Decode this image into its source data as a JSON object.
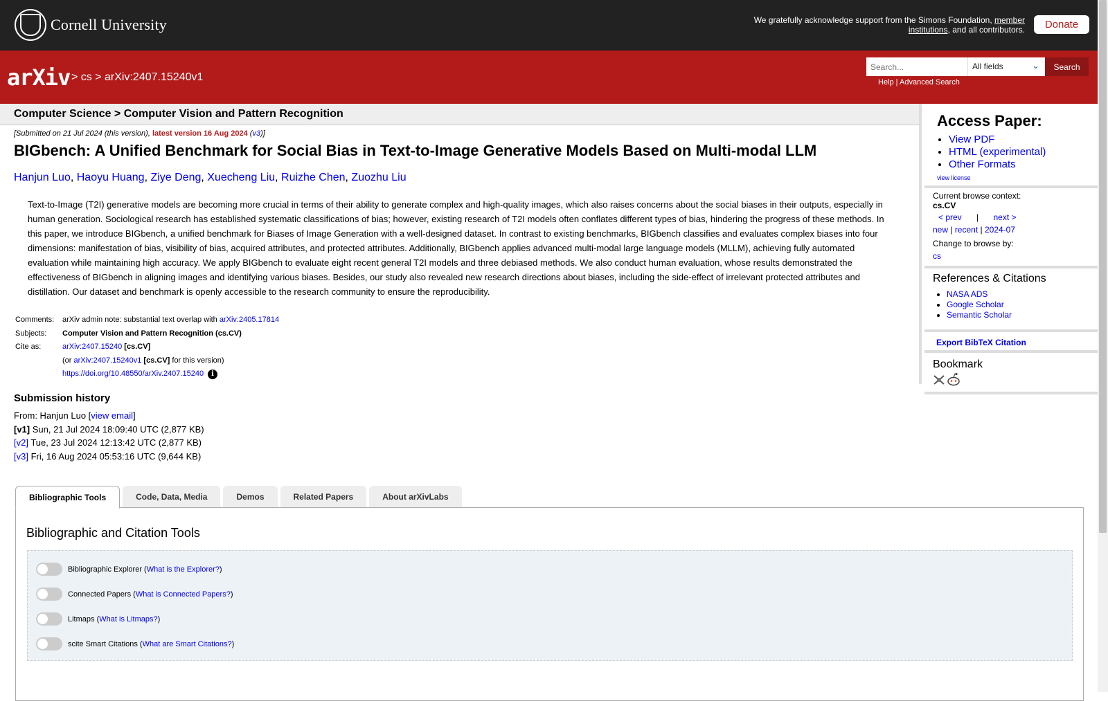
{
  "topbar": {
    "university": "Cornell University",
    "ack_text": "We gratefully acknowledge support from the Simons Foundation, ",
    "ack_link": "member institutions",
    "ack_tail": ", and all contributors.",
    "donate": "Donate"
  },
  "header": {
    "logo": "arXiv",
    "breadcrumb_sep": " > ",
    "crumb_cs": "cs",
    "crumb_id": "arXiv:2407.15240v1",
    "search_placeholder": "Search...",
    "search_field": "All fields",
    "search_button": "Search",
    "help": "Help",
    "advanced": "Advanced Search"
  },
  "subject_header": "Computer Science > Computer Vision and Pattern Recognition",
  "dateline": {
    "submitted": "[Submitted on 21 Jul 2024 (this version), ",
    "latest": "latest version 16 Aug 2024",
    "v3": "v3"
  },
  "paper": {
    "title": "BIGbench: A Unified Benchmark for Social Bias in Text-to-Image Generative Models Based on Multi-modal LLM",
    "authors": [
      "Hanjun Luo",
      "Haoyu Huang",
      "Ziye Deng",
      "Xuecheng Liu",
      "Ruizhe Chen",
      "Zuozhu Liu"
    ],
    "abstract": "Text-to-Image (T2I) generative models are becoming more crucial in terms of their ability to generate complex and high-quality images, which also raises concerns about the social biases in their outputs, especially in human generation. Sociological research has established systematic classifications of bias; however, existing research of T2I models often conflates different types of bias, hindering the progress of these methods. In this paper, we introduce BIGbench, a unified benchmark for Biases of Image Generation with a well-designed dataset. In contrast to existing benchmarks, BIGbench classifies and evaluates complex biases into four dimensions: manifestation of bias, visibility of bias, acquired attributes, and protected attributes. Additionally, BIGbench applies advanced multi-modal large language models (MLLM), achieving fully automated evaluation while maintaining high accuracy. We apply BIGbench to evaluate eight recent general T2I models and three debiased methods. We also conduct human evaluation, whose results demonstrated the effectiveness of BIGbench in aligning images and identifying various biases. Besides, our study also revealed new research directions about biases, including the side-effect of irrelevant protected attributes and distillation. Our dataset and benchmark is openly accessible to the research community to ensure the reproducibility."
  },
  "meta": {
    "comments_label": "Comments:",
    "comments_text": "arXiv admin note: substantial text overlap with ",
    "comments_link": "arXiv:2405.17814",
    "subjects_label": "Subjects:",
    "subjects": "Computer Vision and Pattern Recognition (cs.CV)",
    "cite_label": "Cite as:",
    "cite_id": "arXiv:2407.15240",
    "cite_cat": "[cs.CV]",
    "or_pre": "(or ",
    "or_id": "arXiv:2407.15240v1",
    "or_cat": "[cs.CV]",
    "or_post": " for this version)",
    "doi": "https://doi.org/10.48550/arXiv.2407.15240",
    "info_icon": "i"
  },
  "history": {
    "title": "Submission history",
    "from": "From: Hanjun Luo [",
    "view_email": "view email",
    "from_close": "]",
    "versions": [
      {
        "tag": "[v1]",
        "text": " Sun, 21 Jul 2024 18:09:40 UTC (2,877 KB)"
      },
      {
        "tag": "[v2]",
        "text": " Tue, 23 Jul 2024 12:13:42 UTC (2,877 KB)"
      },
      {
        "tag": "[v3]",
        "text": " Fri, 16 Aug 2024 05:53:16 UTC (9,644 KB)"
      }
    ]
  },
  "sidebar": {
    "access_title": "Access Paper:",
    "access_links": [
      "View PDF",
      "HTML (experimental)",
      "Other Formats"
    ],
    "view_license": "view license",
    "context_label": "Current browse context:",
    "context": "cs.CV",
    "prev": "< prev",
    "pipe": "|",
    "next": "next >",
    "new": "new",
    "recent": "recent",
    "month": "2024-07",
    "change_label": "Change to browse by:",
    "cs": "cs",
    "refs_title": "References & Citations",
    "refs": [
      "NASA ADS",
      "Google Scholar",
      "Semantic Scholar"
    ],
    "bibtex": "Export BibTeX Citation",
    "bookmark_title": "Bookmark"
  },
  "tabs": [
    "Bibliographic Tools",
    "Code, Data, Media",
    "Demos",
    "Related Papers",
    "About arXivLabs"
  ],
  "panel": {
    "title": "Bibliographic and Citation Tools",
    "tools": [
      {
        "name": "Bibliographic Explorer",
        "link": "What is the Explorer?"
      },
      {
        "name": "Connected Papers",
        "link": "What is Connected Papers?"
      },
      {
        "name": "Litmaps",
        "link": "What is Litmaps?"
      },
      {
        "name": "scite Smart Citations",
        "link": "What are Smart Citations?"
      }
    ]
  },
  "colors": {
    "arxiv_red": "#b31b1b",
    "topbar": "#222222",
    "link": "#0000ee"
  }
}
